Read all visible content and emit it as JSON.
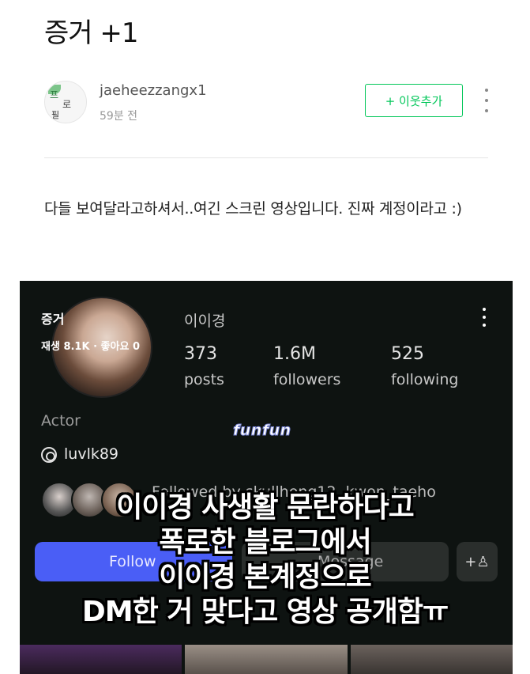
{
  "post": {
    "title": "증거 +1",
    "author": {
      "name": "jaeheezzangx1",
      "time": "59분 전",
      "avatar_text": [
        "프",
        "로",
        "필"
      ]
    },
    "add_neighbor_label": "+ 이웃추가",
    "body": "다들 보여달라고하셔서..여긴 스크린 영상입니다. 진짜 계정이라고 :)"
  },
  "video": {
    "label": "증거",
    "stats": "재생 8.1K · 좋아요 0",
    "watermark": "funfun",
    "profile": {
      "name": "이이경",
      "stats": [
        {
          "value": "373",
          "label": "posts"
        },
        {
          "value": "1.6M",
          "label": "followers"
        },
        {
          "value": "525",
          "label": "following"
        }
      ],
      "category": "Actor",
      "threads_handle": "luvlk89",
      "followed_by": "Followed by skullhong12, kwon_taeho",
      "follow_label": "Follow",
      "message_label": "Message",
      "add_person_icon": "add-person-icon"
    },
    "caption_lines": [
      "이이경 사생활 문란하다고",
      "폭로한 블로그에서",
      "이이경 본계정으로",
      "DM한 거 맞다고 영상 공개함ㅠ"
    ]
  },
  "colors": {
    "accent_green": "#03c75a",
    "instagram_blue": "#4a5ef6",
    "video_bg": "#0e1311"
  }
}
